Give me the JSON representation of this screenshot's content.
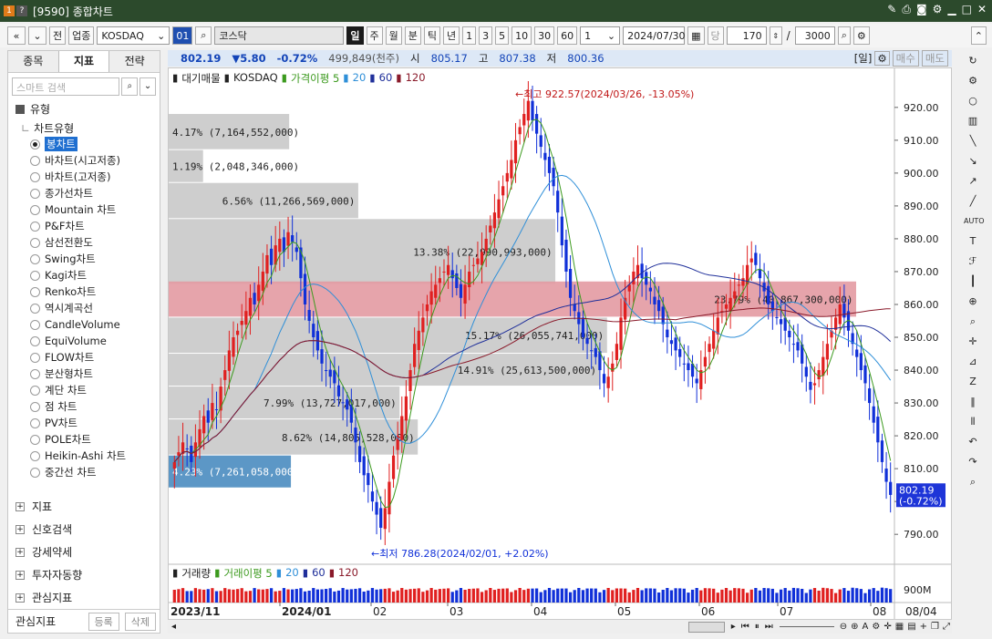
{
  "window": {
    "title": "[9590] 종합차트",
    "badge1": "1",
    "badge2": "?"
  },
  "toolbar": {
    "nav_prev": "«",
    "nav_menu": "⌄",
    "btn_all": "전",
    "btn_sector": "업종",
    "market": "KOSDAQ",
    "code": "01",
    "search_icon": "⌕",
    "name": "코스닥",
    "periods": [
      "일",
      "주",
      "월",
      "분",
      "틱",
      "년"
    ],
    "active_period": "일",
    "intervals": [
      "1",
      "3",
      "5",
      "10",
      "30",
      "60"
    ],
    "count_small": "1",
    "date": "2024/07/30",
    "unit": "당",
    "bars": "170",
    "slash": "/",
    "max_bars": "3000"
  },
  "left_panel": {
    "tabs": [
      "종목",
      "지표",
      "전략"
    ],
    "active_tab": "지표",
    "search_placeholder": "스마트 검색",
    "section_type": "유형",
    "chart_type_header": "차트유형",
    "chart_types": [
      "봉차트",
      "바차트(시고저종)",
      "바차트(고저종)",
      "종가선차트",
      "Mountain 차트",
      "P&F차트",
      "삼선전환도",
      "Swing차트",
      "Kagi차트",
      "Renko차트",
      "역시계곡선",
      "CandleVolume",
      "EquiVolume",
      "FLOW차트",
      "분산형차트",
      "계단 차트",
      "점 차트",
      "PV차트",
      "POLE차트",
      "Heikin-Ashi 차트",
      "중간선 차트"
    ],
    "selected_type": "봉차트",
    "groups": [
      "지표",
      "신호검색",
      "강세약세",
      "투자자동향",
      "관심지표"
    ],
    "bottom_label": "관심지표",
    "bottom_btn1": "등록",
    "bottom_btn2": "삭제"
  },
  "quote": {
    "price": "802.19",
    "change": "▼5.80",
    "pct": "-0.72%",
    "volume": "499,849(천주)",
    "open_label": "시",
    "open": "805.17",
    "high_label": "고",
    "high": "807.38",
    "low_label": "저",
    "low": "800.36",
    "period_tag": "[일]",
    "buy": "매수",
    "sell": "매도"
  },
  "legend": {
    "items": [
      "대기매물",
      "KOSDAQ",
      "가격이평 5",
      "20",
      "60",
      "120"
    ],
    "colors": [
      "#222222",
      "#222222",
      "#3c9a1e",
      "#2f8fd8",
      "#1f2f9a",
      "#8a1a2a"
    ]
  },
  "volume_legend": {
    "items": [
      "거래량",
      "거래이평 5",
      "20",
      "60",
      "120"
    ],
    "colors": [
      "#222222",
      "#3c9a1e",
      "#2f8fd8",
      "#1f2f9a",
      "#8a1a2a"
    ],
    "axis_label": "900M"
  },
  "annotations": {
    "high": "←최고 922.57(2024/03/26, -13.05%)",
    "low": "←최저 786.28(2024/02/01, +2.02%)",
    "last_price": "802.19",
    "last_pct": "(-0.72%)"
  },
  "date_axis": [
    "2023/11",
    "2024/01",
    "02",
    "03",
    "04",
    "05",
    "06",
    "07",
    "08",
    "08/04"
  ],
  "chart_data": {
    "type": "candlestick",
    "title": "KOSDAQ",
    "ylim": [
      782,
      928
    ],
    "y_ticks": [
      790,
      800,
      810,
      820,
      830,
      840,
      850,
      860,
      870,
      880,
      890,
      900,
      910,
      920
    ],
    "volume_profile": [
      {
        "low": 907,
        "high": 918,
        "pct": "4.17%",
        "vol": "7,164,552,000"
      },
      {
        "low": 897,
        "high": 907,
        "pct": "1.19%",
        "vol": "2,048,346,000"
      },
      {
        "low": 886,
        "high": 897,
        "pct": "6.56%",
        "vol": "11,266,569,000"
      },
      {
        "low": 866,
        "high": 886,
        "pct": "13.38%",
        "vol": "22,990,993,000"
      },
      {
        "low": 856,
        "high": 867,
        "pct": "23.79%",
        "vol": "40,867,300,000"
      },
      {
        "low": 845,
        "high": 856,
        "pct": "15.17%",
        "vol": "26,055,741,000"
      },
      {
        "low": 835,
        "high": 845,
        "pct": "14.91%",
        "vol": "25,613,500,000"
      },
      {
        "low": 825,
        "high": 835,
        "pct": "7.99%",
        "vol": "13,727,017,000"
      },
      {
        "low": 814,
        "high": 825,
        "pct": "8.62%",
        "vol": "14,805,528,000"
      },
      {
        "low": 804,
        "high": 814,
        "pct": "4.23%",
        "vol": "7,261,058,000"
      }
    ],
    "closes": [
      812,
      815,
      818,
      816,
      812,
      818,
      822,
      826,
      824,
      830,
      828,
      835,
      840,
      846,
      850,
      852,
      855,
      858,
      862,
      860,
      866,
      870,
      875,
      872,
      878,
      880,
      876,
      882,
      879,
      876,
      868,
      860,
      855,
      850,
      846,
      842,
      840,
      838,
      836,
      832,
      830,
      828,
      824,
      818,
      812,
      808,
      805,
      800,
      796,
      792,
      798,
      806,
      814,
      820,
      826,
      832,
      840,
      848,
      852,
      856,
      860,
      864,
      866,
      868,
      870,
      872,
      868,
      865,
      862,
      866,
      870,
      872,
      874,
      876,
      880,
      884,
      888,
      892,
      896,
      900,
      904,
      910,
      914,
      918,
      922,
      916,
      912,
      908,
      904,
      900,
      896,
      888,
      878,
      870,
      862,
      858,
      854,
      850,
      848,
      846,
      844,
      840,
      836,
      838,
      842,
      848,
      856,
      862,
      866,
      870,
      872,
      868,
      866,
      864,
      860,
      858,
      854,
      850,
      848,
      846,
      844,
      842,
      840,
      838,
      836,
      840,
      844,
      848,
      852,
      856,
      858,
      860,
      862,
      864,
      866,
      868,
      872,
      874,
      872,
      868,
      864,
      860,
      858,
      856,
      854,
      852,
      850,
      848,
      846,
      842,
      838,
      834,
      836,
      840,
      844,
      848,
      852,
      856,
      860,
      856,
      852,
      848,
      844,
      840,
      836,
      830,
      824,
      818,
      812,
      806,
      802
    ]
  }
}
